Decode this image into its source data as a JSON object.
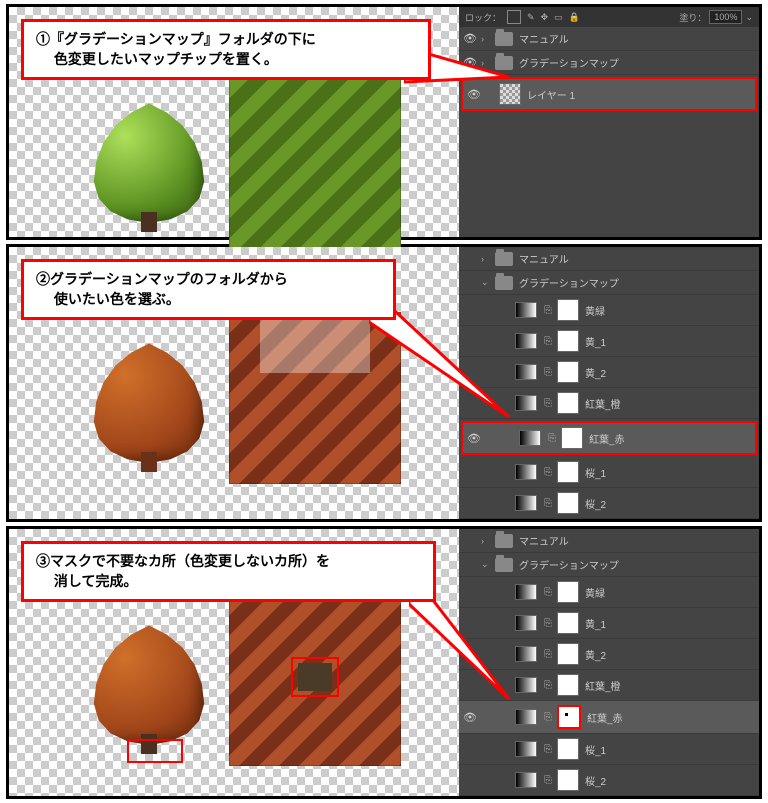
{
  "lockbar": {
    "label": "ロック：",
    "fill_label": "塗り：",
    "fill_value": "100%"
  },
  "folders": {
    "manual": "マニュアル",
    "gradmap": "グラデーションマップ"
  },
  "step1": {
    "callout": "①『グラデーションマップ』フォルダの下に\n　 色変更したいマップチップを置く。",
    "layer": "レイヤー 1"
  },
  "step2": {
    "callout": "②グラデーションマップのフォルダから\n　 使いたい色を選ぶ。",
    "layers": [
      "黄緑",
      "黄_1",
      "黄_2",
      "紅葉_橙",
      "紅葉_赤",
      "桜_1",
      "桜_2"
    ]
  },
  "step3": {
    "callout": "③マスクで不要なカ所（色変更しないカ所）を\n　 消して完成。",
    "layers": [
      "黄緑",
      "黄_1",
      "黄_2",
      "紅葉_橙",
      "紅葉_赤",
      "桜_1",
      "桜_2"
    ]
  }
}
